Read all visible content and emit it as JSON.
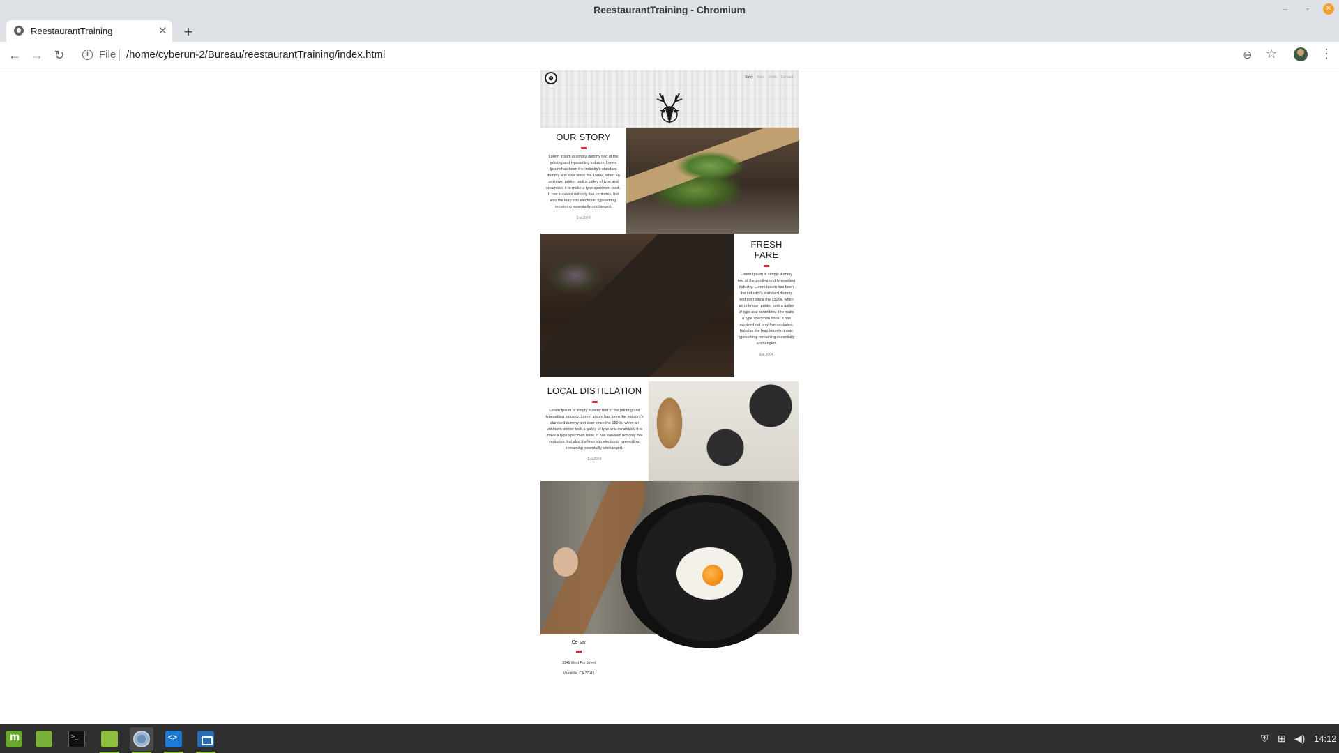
{
  "window": {
    "title": "ReestaurantTraining - Chromium",
    "min_glyph": "–",
    "max_glyph": "▫",
    "close_glyph": "✕"
  },
  "tab": {
    "title": "ReestaurantTraining",
    "close_glyph": "✕",
    "new_tab_glyph": "+"
  },
  "toolbar": {
    "back_glyph": "←",
    "forward_glyph": "→",
    "reload_glyph": "↻",
    "info_glyph": "i",
    "scheme": "File",
    "url": "/home/cyberun-2/Bureau/reestaurantTraining/index.html",
    "zoom_glyph": "⊖",
    "star_glyph": "☆",
    "menu_glyph": "⋮"
  },
  "site": {
    "nav": [
      "Story",
      "Fare",
      "Drink",
      "Contact"
    ],
    "nav_active": "Story",
    "logo_glyph": "⊕",
    "story": {
      "title": "OUR STORY",
      "body": "Lorem Ipsum is simply dummy text of the printing and typesetting industry. Lorem Ipsum has been the industry's standard dummy text ever since the 1500s, when an unknown printer took a galley of type and scrambled it to make a type specimen book. It has survived not only five centuries, but also the leap into electronic typesetting, remaining essentially unchanged.",
      "est": "Est.2004"
    },
    "fare": {
      "title_line1": "FRESH",
      "title_line2": "FARE",
      "body": "Lorem Ipsum is simply dummy text of the printing and typesetting industry. Lorem Ipsum has been the industry's standard dummy text ever since the 1500s, when an unknown printer took a galley of type and scrambled it to make a type specimen book. It has survived not only five centuries, but also the leap into electronic typesetting, remaining essentially unchanged.",
      "est": "Est.2004"
    },
    "distillation": {
      "title": "LOCAL DISTILLATION",
      "body": "Lorem Ipsum is simply dummy text of the printing and typesetting industry. Lorem Ipsum has been the industry's standard dummy text ever since the 1500s, when an unknown printer took a galley of type and scrambled it to make a type specimen book. It has survived not only five centuries, but also the leap into electronic typesetting, remaining essentially unchanged.",
      "est": "Est.2004"
    },
    "footer": {
      "name": "Ce sar",
      "address_line1": "3346 West Pro Street",
      "address_line2": "Vermilille, CA 77045"
    }
  },
  "taskbar": {
    "apps": [
      "menu-icon",
      "desktop-icon",
      "terminal-icon",
      "files-icon",
      "chromium-icon",
      "vscode-icon",
      "screenshot-icon"
    ],
    "tray_shield_glyph": "⛨",
    "tray_network_glyph": "⊞",
    "tray_volume_glyph": "◀)",
    "clock": "14:12"
  },
  "colors": {
    "accent_red": "#d62534",
    "chrome_gray": "#dee1e6",
    "taskbar": "#2f2f2f",
    "mint_green": "#8fbf3f"
  }
}
